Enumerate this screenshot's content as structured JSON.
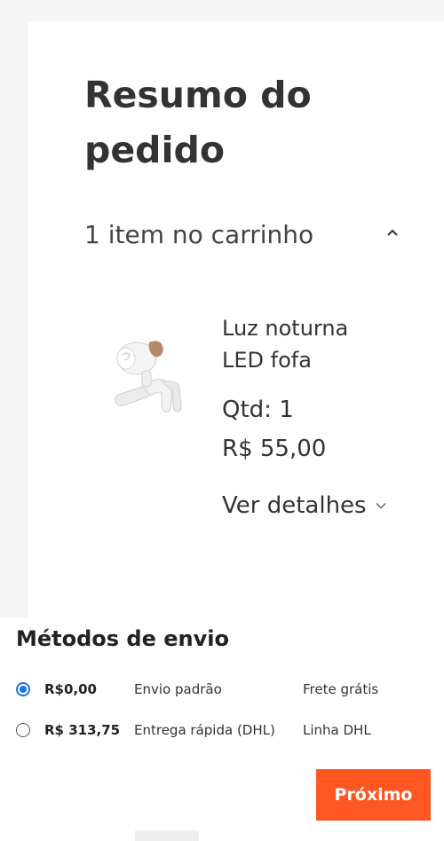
{
  "summary": {
    "title": "Resumo do pedido",
    "cart_count": "1 item no carrinho"
  },
  "product": {
    "name": "Luz noturna LED fofa",
    "qty": "Qtd: 1",
    "price": "R$ 55,00",
    "details_label": "Ver detalhes"
  },
  "shipping": {
    "title": "Métodos de envio",
    "options": [
      {
        "price": "R$0,00",
        "method": "Envio padrão",
        "note": "Frete grátis",
        "selected": true
      },
      {
        "price": "R$ 313,75",
        "method": "Entrega rápida (DHL)",
        "note": "Linha DHL",
        "selected": false
      }
    ]
  },
  "actions": {
    "next_label": "Próximo"
  },
  "colors": {
    "accent": "#ff5722",
    "radio_selected": "#1a73e8",
    "page_background": "#f5f5f5"
  },
  "icons": {
    "cart_toggle": "chevron-up-icon",
    "details_toggle": "chevron-down-icon"
  }
}
